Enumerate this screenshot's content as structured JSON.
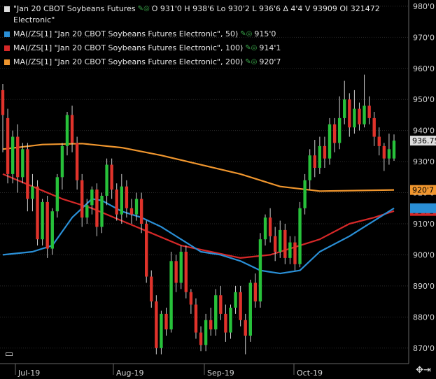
{
  "legend": {
    "main": {
      "name": "\"Jan 20 CBOT Soybeans Futures",
      "name2": "Electronic\"",
      "ohlc": "O 931'0  H 938'6  Lo 930'2  L 936'6  ∆ 4'4  V 93909  OI 321472",
      "color": "#dddddd"
    },
    "ma50": {
      "label": "MA(/ZS[1] \"Jan 20 CBOT Soybeans Futures Electronic\", 50)",
      "value": "915'0",
      "color": "#2a8fd6"
    },
    "ma100": {
      "label": "MA(/ZS[1] \"Jan 20 CBOT Soybeans Futures Electronic\", 100)",
      "value": "914'1",
      "color": "#d62828"
    },
    "ma200": {
      "label": "MA(/ZS[1] \"Jan 20 CBOT Soybeans Futures Electronic\", 200)",
      "value": "920'7",
      "color": "#f0962e"
    }
  },
  "icons": {
    "corner": "minus-icon",
    "nav": "cross-arrows-icon"
  },
  "chart_data": {
    "type": "candlestick",
    "y_ticks": [
      "980'0",
      "970'0",
      "960'0",
      "950'0",
      "940'0",
      "930'0",
      "920'0",
      "910'0",
      "900'0",
      "890'0",
      "880'0",
      "870'0"
    ],
    "ylim": [
      865,
      982
    ],
    "x_labels": [
      "Jul-19",
      "Aug-19",
      "Sep-19",
      "Oct-19"
    ],
    "price_tags": [
      {
        "value": 936.75,
        "text": "936.75",
        "bg": "#dddddd",
        "fg": "#000000"
      },
      {
        "value": 920.875,
        "text": "920'7",
        "bg": "#f0962e",
        "fg": "#000000"
      },
      {
        "value": 914.125,
        "text": "914'1",
        "bg": "#d62828",
        "fg": "#000000"
      },
      {
        "value": 915.0,
        "text": "",
        "bg": "#2a8fd6",
        "fg": "#000000"
      }
    ],
    "colors": {
      "up": "#27c13a",
      "down": "#e0332b",
      "grid": "#2a2a2a"
    },
    "candles": [
      [
        953,
        945,
        955,
        933
      ],
      [
        944,
        926,
        947,
        923
      ],
      [
        926,
        938,
        940,
        923
      ],
      [
        938,
        925,
        942,
        920
      ],
      [
        925,
        934,
        936,
        923
      ],
      [
        934,
        918,
        936,
        914
      ],
      [
        918,
        922,
        926,
        914
      ],
      [
        922,
        905,
        924,
        903
      ],
      [
        905,
        917,
        918,
        903
      ],
      [
        917,
        902,
        919,
        899
      ],
      [
        902,
        914,
        915,
        900
      ],
      [
        914,
        925,
        926,
        912
      ],
      [
        925,
        935,
        936,
        921
      ],
      [
        935,
        945,
        946,
        932
      ],
      [
        945,
        936,
        948,
        933
      ],
      [
        936,
        924,
        938,
        921
      ],
      [
        924,
        912,
        926,
        909
      ],
      [
        912,
        916,
        918,
        910
      ],
      [
        916,
        921,
        922,
        913
      ],
      [
        921,
        909,
        923,
        906
      ],
      [
        909,
        919,
        920,
        907
      ],
      [
        919,
        929,
        931,
        916
      ],
      [
        929,
        921,
        931,
        918
      ],
      [
        921,
        913,
        923,
        911
      ],
      [
        913,
        922,
        926,
        910
      ],
      [
        922,
        915,
        924,
        912
      ],
      [
        915,
        913,
        918,
        910
      ],
      [
        913,
        918,
        920,
        911
      ],
      [
        918,
        910,
        920,
        907
      ],
      [
        910,
        893,
        911,
        891
      ],
      [
        893,
        885,
        895,
        883
      ],
      [
        885,
        870,
        887,
        868
      ],
      [
        870,
        881,
        882,
        868
      ],
      [
        881,
        876,
        883,
        874
      ],
      [
        876,
        898,
        901,
        875
      ],
      [
        898,
        891,
        900,
        888
      ],
      [
        891,
        901,
        903,
        889
      ],
      [
        901,
        888,
        903,
        886
      ],
      [
        888,
        884,
        889,
        881
      ],
      [
        884,
        875,
        886,
        873
      ],
      [
        875,
        871,
        877,
        869
      ],
      [
        871,
        879,
        881,
        869
      ],
      [
        879,
        876,
        883,
        874
      ],
      [
        876,
        887,
        889,
        874
      ],
      [
        887,
        881,
        890,
        879
      ],
      [
        881,
        875,
        884,
        872
      ],
      [
        875,
        883,
        884,
        873
      ],
      [
        883,
        888,
        890,
        881
      ],
      [
        888,
        879,
        890,
        877
      ],
      [
        879,
        874,
        881,
        868
      ],
      [
        874,
        891,
        892,
        872
      ],
      [
        891,
        885,
        894,
        883
      ],
      [
        885,
        905,
        907,
        883
      ],
      [
        905,
        912,
        913,
        903
      ],
      [
        912,
        906,
        915,
        904
      ],
      [
        906,
        901,
        909,
        898
      ],
      [
        901,
        908,
        911,
        899
      ],
      [
        908,
        899,
        910,
        897
      ],
      [
        899,
        904,
        906,
        897
      ],
      [
        904,
        897,
        906,
        895
      ],
      [
        897,
        915,
        917,
        896
      ],
      [
        915,
        924,
        926,
        913
      ],
      [
        924,
        932,
        934,
        921
      ],
      [
        932,
        928,
        937,
        925
      ],
      [
        928,
        935,
        938,
        926
      ],
      [
        935,
        931,
        938,
        928
      ],
      [
        931,
        942,
        944,
        929
      ],
      [
        942,
        936,
        944,
        933
      ],
      [
        936,
        944,
        951,
        934
      ],
      [
        944,
        950,
        956,
        942
      ],
      [
        950,
        941,
        952,
        938
      ],
      [
        941,
        947,
        953,
        939
      ],
      [
        947,
        942,
        949,
        940
      ],
      [
        942,
        948,
        958,
        941
      ],
      [
        948,
        944,
        951,
        942
      ],
      [
        944,
        938,
        946,
        935
      ],
      [
        938,
        935,
        941,
        932
      ],
      [
        935,
        931,
        936,
        927
      ],
      [
        931,
        934,
        939,
        929
      ],
      [
        931,
        936.75,
        938.75,
        930.25
      ]
    ],
    "series": [
      {
        "name": "MA 200",
        "color": "#f0962e",
        "values": [
          [
            0,
            934
          ],
          [
            8,
            935.5
          ],
          [
            16,
            935.8
          ],
          [
            24,
            934.5
          ],
          [
            32,
            932
          ],
          [
            40,
            929
          ],
          [
            48,
            926
          ],
          [
            56,
            922
          ],
          [
            64,
            920.5
          ],
          [
            79,
            920.9
          ]
        ]
      },
      {
        "name": "MA 100",
        "color": "#d62828",
        "values": [
          [
            0,
            926
          ],
          [
            6,
            922
          ],
          [
            12,
            918
          ],
          [
            18,
            915
          ],
          [
            24,
            911
          ],
          [
            30,
            907
          ],
          [
            36,
            903
          ],
          [
            42,
            901
          ],
          [
            48,
            899
          ],
          [
            54,
            900
          ],
          [
            60,
            903
          ],
          [
            64,
            905
          ],
          [
            70,
            910
          ],
          [
            75,
            912
          ],
          [
            79,
            914.1
          ]
        ]
      },
      {
        "name": "MA 50",
        "color": "#2a8fd6",
        "values": [
          [
            0,
            900
          ],
          [
            6,
            901
          ],
          [
            10,
            903
          ],
          [
            14,
            912
          ],
          [
            18,
            918
          ],
          [
            20,
            917.5
          ],
          [
            24,
            914
          ],
          [
            28,
            912
          ],
          [
            32,
            909
          ],
          [
            36,
            905
          ],
          [
            40,
            901
          ],
          [
            44,
            900
          ],
          [
            48,
            898
          ],
          [
            52,
            895
          ],
          [
            56,
            894
          ],
          [
            60,
            895
          ],
          [
            64,
            901
          ],
          [
            70,
            906
          ],
          [
            75,
            911
          ],
          [
            79,
            915
          ]
        ]
      }
    ],
    "grid": true
  }
}
